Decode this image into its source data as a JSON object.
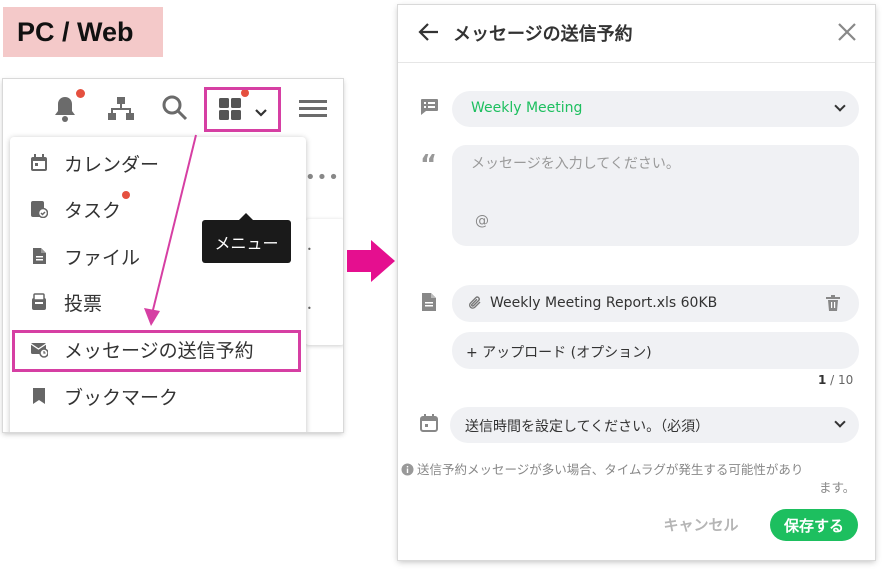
{
  "label": "PC / Web",
  "tooltip": "メニュー",
  "menu": {
    "items": [
      {
        "label": "カレンダー",
        "icon": "calendar-icon"
      },
      {
        "label": "タスク",
        "icon": "task-icon"
      },
      {
        "label": "ファイル",
        "icon": "file-icon"
      },
      {
        "label": "投票",
        "icon": "vote-icon"
      },
      {
        "label": "メッセージの送信予約",
        "icon": "scheduled-message-icon"
      },
      {
        "label": "ブックマーク",
        "icon": "bookmark-icon"
      }
    ]
  },
  "dialog": {
    "title": "メッセージの送信予約",
    "room": "Weekly Meeting",
    "message_placeholder": "メッセージを入力してください。",
    "mention": "@",
    "attachment": "Weekly Meeting Report.xls 60KB",
    "upload": "+ アップロード (オプション)",
    "count_current": "1",
    "count_sep": " / 10",
    "time_placeholder": "送信時間を設定してください。（必須）",
    "notice_line1": "送信予約メッセージが多い場合、タイムラグが発生する可能性があり",
    "notice_line2": "ます。",
    "cancel": "キャンセル",
    "save": "保存する"
  },
  "colors": {
    "accent_green": "#1dbf5f",
    "highlight_pink": "#d63fa3",
    "badge_red": "#e5503f"
  }
}
